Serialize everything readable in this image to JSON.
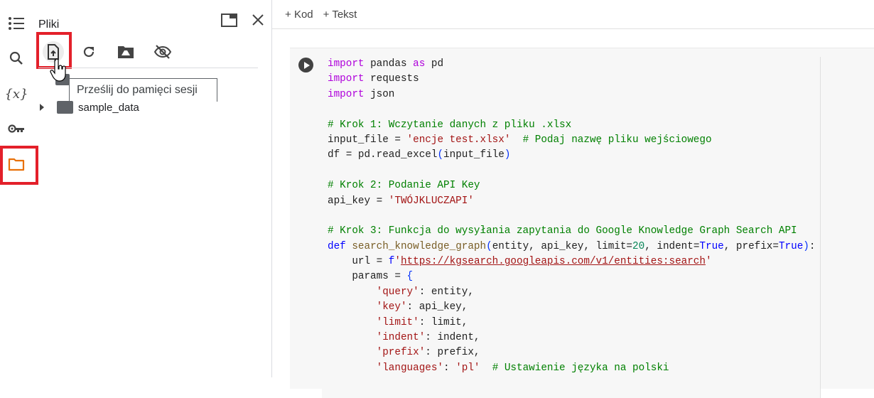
{
  "rail": {
    "icons": [
      "toc-icon",
      "search-icon",
      "variables-icon",
      "key-icon",
      "folder-icon"
    ],
    "variables_label": "{x}"
  },
  "panel": {
    "title": "Pliki",
    "tooltip": "Prześlij do pamięci sesji",
    "tree": [
      {
        "name": "sample_data"
      }
    ],
    "accent": "#e8710a",
    "highlight": "#e3202a"
  },
  "toolbar": {
    "add_code": "Kod",
    "add_text": "Tekst",
    "plus": "+"
  },
  "code": [
    [
      [
        "import",
        "kw"
      ],
      [
        " pandas ",
        ""
      ],
      [
        "as",
        "kw"
      ],
      [
        " pd",
        ""
      ]
    ],
    [
      [
        "import",
        "kw"
      ],
      [
        " requests",
        ""
      ]
    ],
    [
      [
        "import",
        "kw"
      ],
      [
        " json",
        ""
      ]
    ],
    [],
    [
      [
        "# Krok 1: Wczytanie danych z pliku .xlsx",
        "com"
      ]
    ],
    [
      [
        "input_file = ",
        ""
      ],
      [
        "'encje test.xlsx'",
        "str"
      ],
      [
        "  ",
        ""
      ],
      [
        "# Podaj nazwę pliku wejściowego",
        "com"
      ]
    ],
    [
      [
        "df = pd.read_excel",
        ""
      ],
      [
        "(",
        "br"
      ],
      [
        "input_file",
        ""
      ],
      [
        ")",
        "br"
      ]
    ],
    [],
    [
      [
        "# Krok 2: Podanie API Key",
        "com"
      ]
    ],
    [
      [
        "api_key = ",
        ""
      ],
      [
        "'TWÓJKLUCZAPI'",
        "str"
      ]
    ],
    [],
    [
      [
        "# Krok 3: Funkcja do wysyłania zapytania do Google Knowledge Graph Search API",
        "com"
      ]
    ],
    [
      [
        "def",
        "kd"
      ],
      [
        " ",
        ""
      ],
      [
        "search_knowledge_graph",
        "fn"
      ],
      [
        "(",
        "br"
      ],
      [
        "entity, api_key, limit=",
        ""
      ],
      [
        "20",
        "num"
      ],
      [
        ", indent=",
        ""
      ],
      [
        "True",
        "kd"
      ],
      [
        ", prefix=",
        ""
      ],
      [
        "True",
        "kd"
      ],
      [
        ")",
        "br"
      ],
      [
        ":",
        ""
      ]
    ],
    [
      [
        "    url = ",
        ""
      ],
      [
        "f",
        "kd"
      ],
      [
        "'",
        "str"
      ],
      [
        "https://kgsearch.googleapis.com/v1/entities:search",
        "str url"
      ],
      [
        "'",
        "str"
      ]
    ],
    [
      [
        "    params = ",
        ""
      ],
      [
        "{",
        "br"
      ]
    ],
    [
      [
        "        ",
        ""
      ],
      [
        "'query'",
        "str"
      ],
      [
        ": entity,",
        ""
      ]
    ],
    [
      [
        "        ",
        ""
      ],
      [
        "'key'",
        "str"
      ],
      [
        ": api_key,",
        ""
      ]
    ],
    [
      [
        "        ",
        ""
      ],
      [
        "'limit'",
        "str"
      ],
      [
        ": limit,",
        ""
      ]
    ],
    [
      [
        "        ",
        ""
      ],
      [
        "'indent'",
        "str"
      ],
      [
        ": indent,",
        ""
      ]
    ],
    [
      [
        "        ",
        ""
      ],
      [
        "'prefix'",
        "str"
      ],
      [
        ": prefix,",
        ""
      ]
    ],
    [
      [
        "        ",
        ""
      ],
      [
        "'languages'",
        "str"
      ],
      [
        ": ",
        ""
      ],
      [
        "'pl'",
        "str"
      ],
      [
        "  ",
        ""
      ],
      [
        "# Ustawienie języka na polski",
        "com"
      ]
    ]
  ]
}
